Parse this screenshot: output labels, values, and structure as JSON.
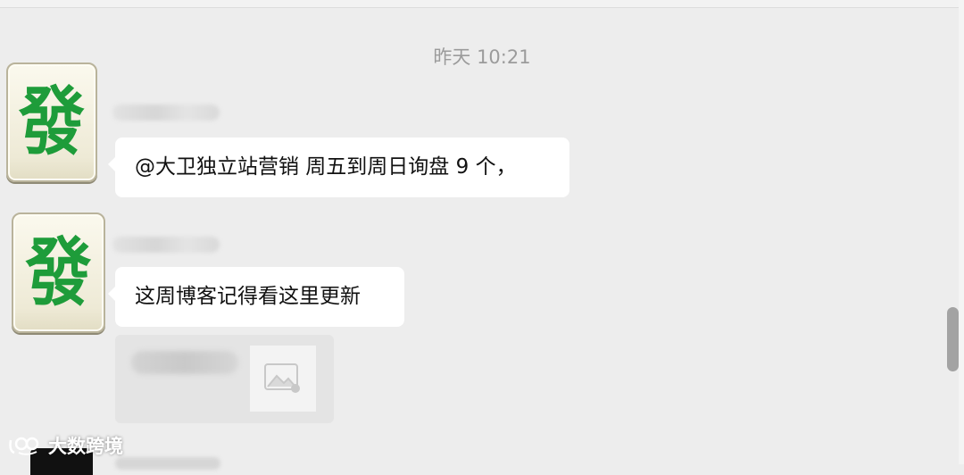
{
  "chat": {
    "timestamp": "昨天 10:21",
    "messages": [
      {
        "avatar_glyph": "發",
        "text": "@大卫独立站营销 周五到周日询盘 9 个，"
      },
      {
        "avatar_glyph": "發",
        "text": "这周博客记得看这里更新"
      }
    ]
  },
  "watermark": {
    "text": "大数跨境"
  },
  "colors": {
    "background": "#ededed",
    "bubble": "#ffffff",
    "avatar_glyph": "#1e9c3a",
    "timestamp": "#9b9b9b"
  },
  "icons": {
    "image_placeholder": "image-icon",
    "watermark_logo": "dashu-logo-icon"
  }
}
